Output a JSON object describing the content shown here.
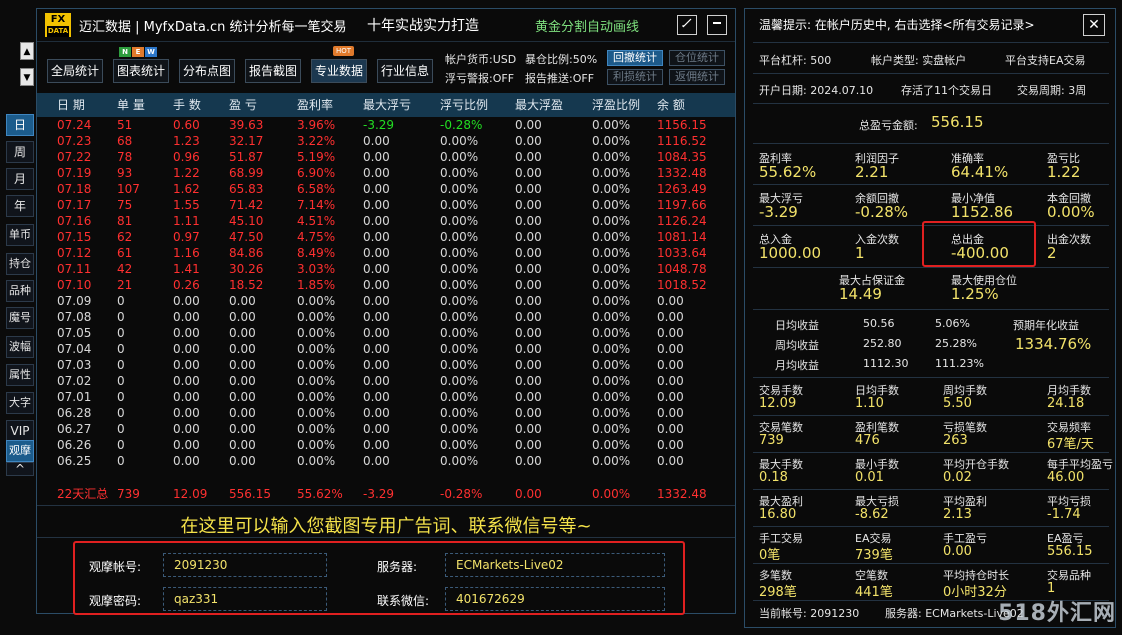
{
  "app": {
    "logo_top": "FX",
    "logo_bottom": "DATA",
    "title": "迈汇数据 | MyfxData.cn  统计分析每一笔交易",
    "slogan": "十年实战实力打造",
    "feature": "黄金分割自动画线",
    "edit_icon": "pencil-icon",
    "minimize_icon": "minimize-icon"
  },
  "side_nav": {
    "up": "▲",
    "down": "▼",
    "expand": "^",
    "items": [
      "日",
      "周",
      "月",
      "年",
      "单币",
      "持仓",
      "品种",
      "魔号",
      "波幅",
      "属性",
      "大字",
      "VIP",
      "观摩"
    ]
  },
  "toolbar": {
    "buttons": [
      "全局统计",
      "图表统计",
      "分布点图",
      "报告截图",
      "专业数据",
      "行业信息"
    ],
    "new_badge": [
      "N",
      "E",
      "W"
    ],
    "hot_badge": "HOT",
    "account_currency": "帐户货币:USD",
    "exposure": "暴仓比例:50%",
    "float_alert": "浮亏警报:OFF",
    "report_push": "报告推送:OFF",
    "mini_buttons": [
      "回撤统计",
      "仓位统计",
      "利损统计",
      "返佣统计"
    ]
  },
  "table": {
    "headers": [
      "日 期",
      "单 量",
      "手 数",
      "盈 亏",
      "盈利率",
      "最大浮亏",
      "浮亏比例",
      "最大浮盈",
      "浮盈比例",
      "余 额"
    ],
    "rows": [
      [
        "07.24",
        "51",
        "0.60",
        "39.63",
        "3.96%",
        "-3.29",
        "-0.28%",
        "0.00",
        "0.00%",
        "1156.15"
      ],
      [
        "07.23",
        "68",
        "1.23",
        "32.17",
        "3.22%",
        "0.00",
        "0.00%",
        "0.00",
        "0.00%",
        "1116.52"
      ],
      [
        "07.22",
        "78",
        "0.96",
        "51.87",
        "5.19%",
        "0.00",
        "0.00%",
        "0.00",
        "0.00%",
        "1084.35"
      ],
      [
        "07.19",
        "93",
        "1.22",
        "68.99",
        "6.90%",
        "0.00",
        "0.00%",
        "0.00",
        "0.00%",
        "1332.48"
      ],
      [
        "07.18",
        "107",
        "1.62",
        "65.83",
        "6.58%",
        "0.00",
        "0.00%",
        "0.00",
        "0.00%",
        "1263.49"
      ],
      [
        "07.17",
        "75",
        "1.55",
        "71.42",
        "7.14%",
        "0.00",
        "0.00%",
        "0.00",
        "0.00%",
        "1197.66"
      ],
      [
        "07.16",
        "81",
        "1.11",
        "45.10",
        "4.51%",
        "0.00",
        "0.00%",
        "0.00",
        "0.00%",
        "1126.24"
      ],
      [
        "07.15",
        "62",
        "0.97",
        "47.50",
        "4.75%",
        "0.00",
        "0.00%",
        "0.00",
        "0.00%",
        "1081.14"
      ],
      [
        "07.12",
        "61",
        "1.16",
        "84.86",
        "8.49%",
        "0.00",
        "0.00%",
        "0.00",
        "0.00%",
        "1033.64"
      ],
      [
        "07.11",
        "42",
        "1.41",
        "30.26",
        "3.03%",
        "0.00",
        "0.00%",
        "0.00",
        "0.00%",
        "1048.78"
      ],
      [
        "07.10",
        "21",
        "0.26",
        "18.52",
        "1.85%",
        "0.00",
        "0.00%",
        "0.00",
        "0.00%",
        "1018.52"
      ],
      [
        "07.09",
        "0",
        "0.00",
        "0.00",
        "0.00%",
        "0.00",
        "0.00%",
        "0.00",
        "0.00%",
        "0.00"
      ],
      [
        "07.08",
        "0",
        "0.00",
        "0.00",
        "0.00%",
        "0.00",
        "0.00%",
        "0.00",
        "0.00%",
        "0.00"
      ],
      [
        "07.05",
        "0",
        "0.00",
        "0.00",
        "0.00%",
        "0.00",
        "0.00%",
        "0.00",
        "0.00%",
        "0.00"
      ],
      [
        "07.04",
        "0",
        "0.00",
        "0.00",
        "0.00%",
        "0.00",
        "0.00%",
        "0.00",
        "0.00%",
        "0.00"
      ],
      [
        "07.03",
        "0",
        "0.00",
        "0.00",
        "0.00%",
        "0.00",
        "0.00%",
        "0.00",
        "0.00%",
        "0.00"
      ],
      [
        "07.02",
        "0",
        "0.00",
        "0.00",
        "0.00%",
        "0.00",
        "0.00%",
        "0.00",
        "0.00%",
        "0.00"
      ],
      [
        "07.01",
        "0",
        "0.00",
        "0.00",
        "0.00%",
        "0.00",
        "0.00%",
        "0.00",
        "0.00%",
        "0.00"
      ],
      [
        "06.28",
        "0",
        "0.00",
        "0.00",
        "0.00%",
        "0.00",
        "0.00%",
        "0.00",
        "0.00%",
        "0.00"
      ],
      [
        "06.27",
        "0",
        "0.00",
        "0.00",
        "0.00%",
        "0.00",
        "0.00%",
        "0.00",
        "0.00%",
        "0.00"
      ],
      [
        "06.26",
        "0",
        "0.00",
        "0.00",
        "0.00%",
        "0.00",
        "0.00%",
        "0.00",
        "0.00%",
        "0.00"
      ],
      [
        "06.25",
        "0",
        "0.00",
        "0.00",
        "0.00%",
        "0.00",
        "0.00%",
        "0.00",
        "0.00%",
        "0.00"
      ]
    ],
    "summary": [
      "22天汇总",
      "739",
      "12.09",
      "556.15",
      "55.62%",
      "-3.29",
      "-0.28%",
      "0.00",
      "0.00%",
      "1332.48"
    ]
  },
  "ad_text": "在这里可以输入您截图专用广告词、联系微信号等~",
  "login": {
    "account_label": "观摩帐号:",
    "account": "2091230",
    "server_label": "服务器:",
    "server": "ECMarkets-Live02",
    "password_label": "观摩密码:",
    "password": "qaz331",
    "wechat_label": "联系微信:",
    "wechat": "401672629"
  },
  "right": {
    "tip": "温馨提示: 在帐户历史中, 右击选择<所有交易记录>",
    "close_icon": "✕",
    "leverage": "平台杠杆:  500",
    "account_type": "帐户类型:  实盘帐户",
    "ea_support": "平台支持EA交易",
    "open_date": "开户日期:  2024.07.10",
    "records": "存活了11个交易日",
    "period": "交易周期:  3周",
    "total_pl_label": "总盈亏金额:",
    "total_pl": "556.15",
    "stats_row1": [
      {
        "label": "盈利率",
        "value": "55.62%"
      },
      {
        "label": "利润因子",
        "value": "2.21"
      },
      {
        "label": "准确率",
        "value": "64.41%"
      },
      {
        "label": "盈亏比",
        "value": "1.22"
      }
    ],
    "stats_row2": [
      {
        "label": "最大浮亏",
        "value": "-3.29"
      },
      {
        "label": "余额回撤",
        "value": "-0.28%"
      },
      {
        "label": "最小净值",
        "value": "1152.86"
      },
      {
        "label": "本金回撤",
        "value": "0.00%"
      }
    ],
    "stats_row3": [
      {
        "label": "总入金",
        "value": "1000.00"
      },
      {
        "label": "入金次数",
        "value": "1"
      },
      {
        "label": "总出金",
        "value": "-400.00"
      },
      {
        "label": "出金次数",
        "value": "2"
      }
    ],
    "stats_row4": [
      {
        "label": "最大占保证金",
        "value": "14.49"
      },
      {
        "label": "最大使用仓位",
        "value": "1.25%"
      }
    ],
    "income": [
      {
        "label": "日均收益",
        "value": "50.56",
        "pct": "5.06%"
      },
      {
        "label": "周均收益",
        "value": "252.80",
        "pct": "25.28%"
      },
      {
        "label": "月均收益",
        "value": "1112.30",
        "pct": "111.23%"
      }
    ],
    "annual_label": "预期年化收益",
    "annual_value": "1334.76%",
    "grid": [
      [
        {
          "label": "交易手数",
          "value": "12.09"
        },
        {
          "label": "日均手数",
          "value": "1.10"
        },
        {
          "label": "周均手数",
          "value": "5.50"
        },
        {
          "label": "月均手数",
          "value": "24.18"
        }
      ],
      [
        {
          "label": "交易笔数",
          "value": "739"
        },
        {
          "label": "盈利笔数",
          "value": "476"
        },
        {
          "label": "亏损笔数",
          "value": "263"
        },
        {
          "label": "交易频率",
          "value": "67笔/天"
        }
      ],
      [
        {
          "label": "最大手数",
          "value": "0.18"
        },
        {
          "label": "最小手数",
          "value": "0.01"
        },
        {
          "label": "平均开仓手数",
          "value": "0.02"
        },
        {
          "label": "每手平均盈亏",
          "value": "46.00"
        }
      ],
      [
        {
          "label": "最大盈利",
          "value": "16.80"
        },
        {
          "label": "最大亏损",
          "value": "-8.62"
        },
        {
          "label": "平均盈利",
          "value": "2.13"
        },
        {
          "label": "平均亏损",
          "value": "-1.74"
        }
      ],
      [
        {
          "label": "手工交易",
          "value": "0笔"
        },
        {
          "label": "EA交易",
          "value": "739笔"
        },
        {
          "label": "手工盈亏",
          "value": "0.00"
        },
        {
          "label": "EA盈亏",
          "value": "556.15"
        }
      ],
      [
        {
          "label": "多笔数",
          "value": "298笔"
        },
        {
          "label": "空笔数",
          "value": "441笔"
        },
        {
          "label": "平均持仓时长",
          "value": "0小时32分"
        },
        {
          "label": "交易品种",
          "value": "1"
        }
      ]
    ],
    "footer_account": "当前帐号:  2091230",
    "footer_server": "服务器:  ECMarkets-Live02"
  },
  "watermark": "518外汇网",
  "colors": {
    "positive": "#ff3030",
    "negative_float": "#22dd22",
    "value_yellow": "#f2e26a",
    "header_bg": "#15384f",
    "highlight": "#e02020"
  }
}
